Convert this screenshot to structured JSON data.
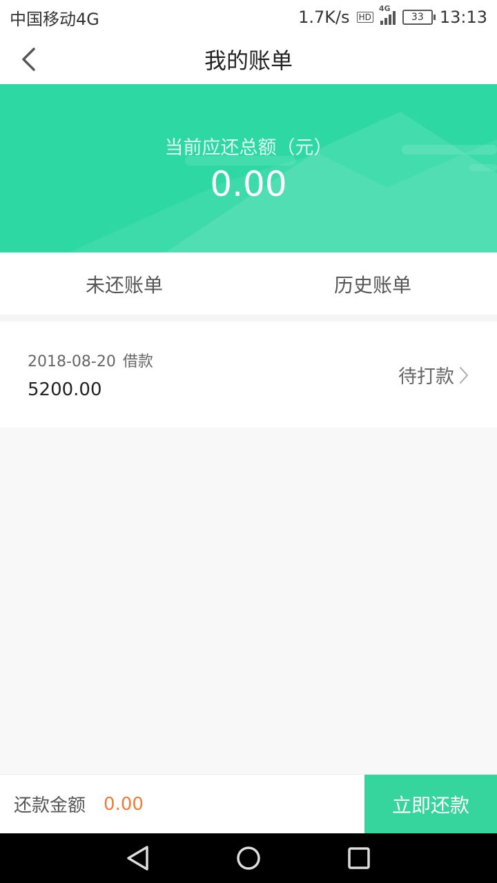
{
  "status_bar": {
    "carrier": "中国移动4G",
    "speed": "1.7K/s",
    "hd": "HD",
    "network": "4G",
    "battery": "33",
    "time": "13:13"
  },
  "header": {
    "title": "我的账单"
  },
  "banner": {
    "label": "当前应还总额（元）",
    "amount": "0.00"
  },
  "tabs": [
    {
      "label": "未还账单",
      "active": true
    },
    {
      "label": "历史账单",
      "active": false
    }
  ],
  "bills": [
    {
      "date": "2018-08-20",
      "type": "借款",
      "amount": "5200.00",
      "status": "待打款"
    }
  ],
  "footer": {
    "label": "还款金额",
    "value": "0.00",
    "button": "立即还款"
  },
  "colors": {
    "accent": "#2ed8a3",
    "button": "#37d59e",
    "amount_orange": "#f07c3c",
    "tab_indicator": "#4fd8b0"
  },
  "icons": {
    "back": "chevron-left-icon",
    "status_arrow": "chevron-right-icon",
    "nav_back": "triangle-back-icon",
    "nav_home": "circle-home-icon",
    "nav_recent": "square-recent-icon"
  }
}
